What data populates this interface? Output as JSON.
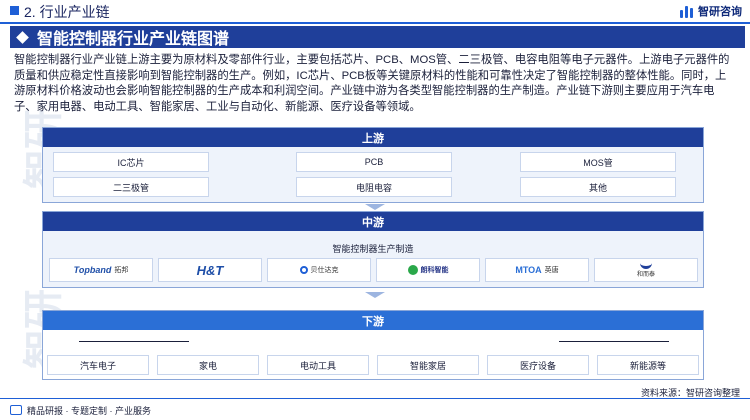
{
  "header": {
    "section": "2. 行业产业链",
    "brand": "智研咨询"
  },
  "title": "智能控制器行业产业链图谱",
  "intro": "智能控制器行业产业链上游主要为原材料及零部件行业，主要包括芯片、PCB、MOS管、二三极管、电容电阻等电子元器件。上游电子元器件的质量和供应稳定性直接影响到智能控制器的生产。例如，IC芯片、PCB板等关键原材料的性能和可靠性决定了智能控制器的整体性能。同时，上游原材料价格波动也会影响智能控制器的生产成本和利润空间。产业链中游为各类型智能控制器的生产制造。产业链下游则主要应用于汽车电子、家用电器、电动工具、智能家居、工业与自动化、新能源、医疗设备等领域。",
  "upstream": {
    "label": "上游",
    "items": [
      "IC芯片",
      "PCB",
      "MOS管",
      "二三极管",
      "电阻电容",
      "其他"
    ]
  },
  "midstream": {
    "label": "中游",
    "subtitle": "智能控制器生产制造",
    "companies": [
      {
        "name": "Topband",
        "cn": "拓邦"
      },
      {
        "name": "H&T",
        "cn": ""
      },
      {
        "name": "",
        "cn": "贝仕达克"
      },
      {
        "name": "",
        "cn": "朗科智能"
      },
      {
        "name": "MTOA",
        "cn": "英唐"
      },
      {
        "name": "",
        "cn": "和而泰"
      }
    ]
  },
  "downstream": {
    "label": "下游",
    "items": [
      "汽车电子",
      "家电",
      "电动工具",
      "智能家居",
      "医疗设备",
      "新能源等"
    ]
  },
  "footer": {
    "left": "精品研报 · 专题定制 · 产业服务",
    "source": "资料来源：智研咨询整理"
  },
  "colors": {
    "primary": "#1f3f9a",
    "accent": "#1e5fd6",
    "panel_bg": "#eef3fb"
  }
}
